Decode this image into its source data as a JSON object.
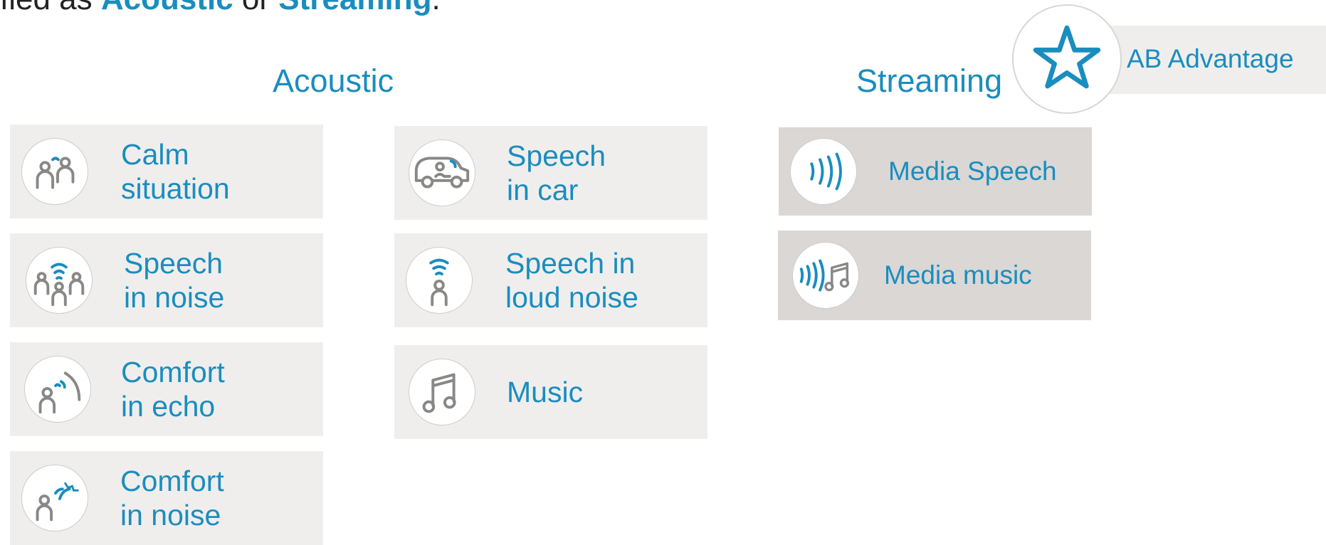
{
  "intro": {
    "prefix": "fied as ",
    "acoustic": "Acoustic",
    "or": " or ",
    "streaming": "Streaming",
    "suffix": "."
  },
  "headings": {
    "acoustic": "Acoustic",
    "streaming": "Streaming"
  },
  "badge": {
    "label": "AB Advantage",
    "icon": "star-icon"
  },
  "acoustic_col1": [
    {
      "line1": "Calm",
      "line2": "situation",
      "icon": "two-people-icon"
    },
    {
      "line1": "Speech",
      "line2": "in noise",
      "icon": "crowd-icon"
    },
    {
      "line1": "Comfort",
      "line2": "in echo",
      "icon": "echo-icon"
    },
    {
      "line1": "Comfort",
      "line2": "in noise",
      "icon": "noise-icon"
    }
  ],
  "acoustic_col2": [
    {
      "line1": "Speech",
      "line2": "in car",
      "icon": "car-icon"
    },
    {
      "line1": "Speech in",
      "line2": "loud noise",
      "icon": "loud-noise-icon"
    },
    {
      "line1": "Music",
      "line2": "",
      "icon": "music-note-icon"
    }
  ],
  "streaming": [
    {
      "label": "Media Speech",
      "icon": "stream-waves-icon"
    },
    {
      "label": "Media music",
      "icon": "stream-music-icon"
    }
  ],
  "colors": {
    "accent": "#1a8dbf",
    "card": "#efeeed",
    "streaming_card": "#dad7d5",
    "icon_gray": "#8a8886"
  }
}
